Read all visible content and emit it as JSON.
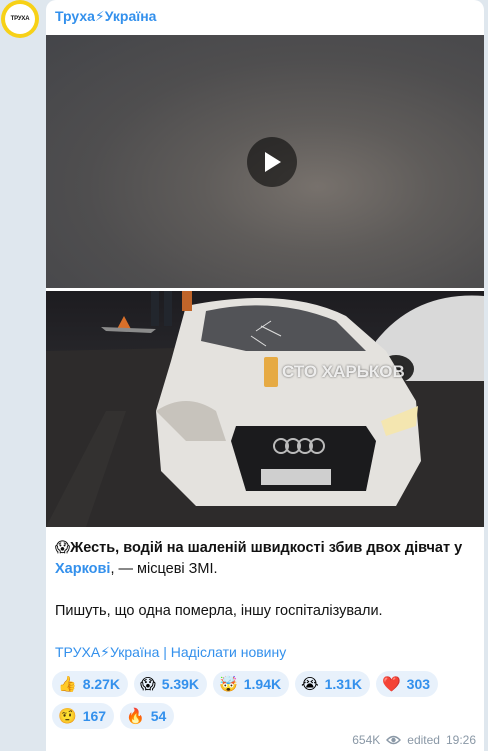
{
  "channel": {
    "name": "Труха⚡Україна",
    "avatar_text": "ТРУХА"
  },
  "video": {
    "play_icon": "play-icon"
  },
  "photo": {
    "watermark": "СТО ХАРЬКОВ"
  },
  "message": {
    "emoji": "😱",
    "line1_bold": "Жесть, водій на шаленій швидкості збив двох дівчат у",
    "link": "Харкові",
    "line1_rest": ", — місцеві ЗМІ.",
    "line2": "Пишуть, що одна померла, іншу госпіталізували.",
    "signature": "ТРУХА⚡Україна | Надіслати новину"
  },
  "reactions": [
    {
      "emoji": "👍",
      "count": "8.27K"
    },
    {
      "emoji": "😱",
      "count": "5.39K"
    },
    {
      "emoji": "🤯",
      "count": "1.94K"
    },
    {
      "emoji": "😭",
      "count": "1.31K"
    },
    {
      "emoji": "❤️",
      "count": "303"
    },
    {
      "emoji": "🤨",
      "count": "167"
    },
    {
      "emoji": "🔥",
      "count": "54"
    }
  ],
  "meta": {
    "views": "654K",
    "eye_icon": "eye-icon",
    "edited": "edited",
    "time": "19:26"
  },
  "colors": {
    "link": "#3390ec",
    "reaction_bg": "#e8f1fb",
    "chat_bg": "#dfe7ee",
    "avatar_ring": "#f7d117"
  }
}
